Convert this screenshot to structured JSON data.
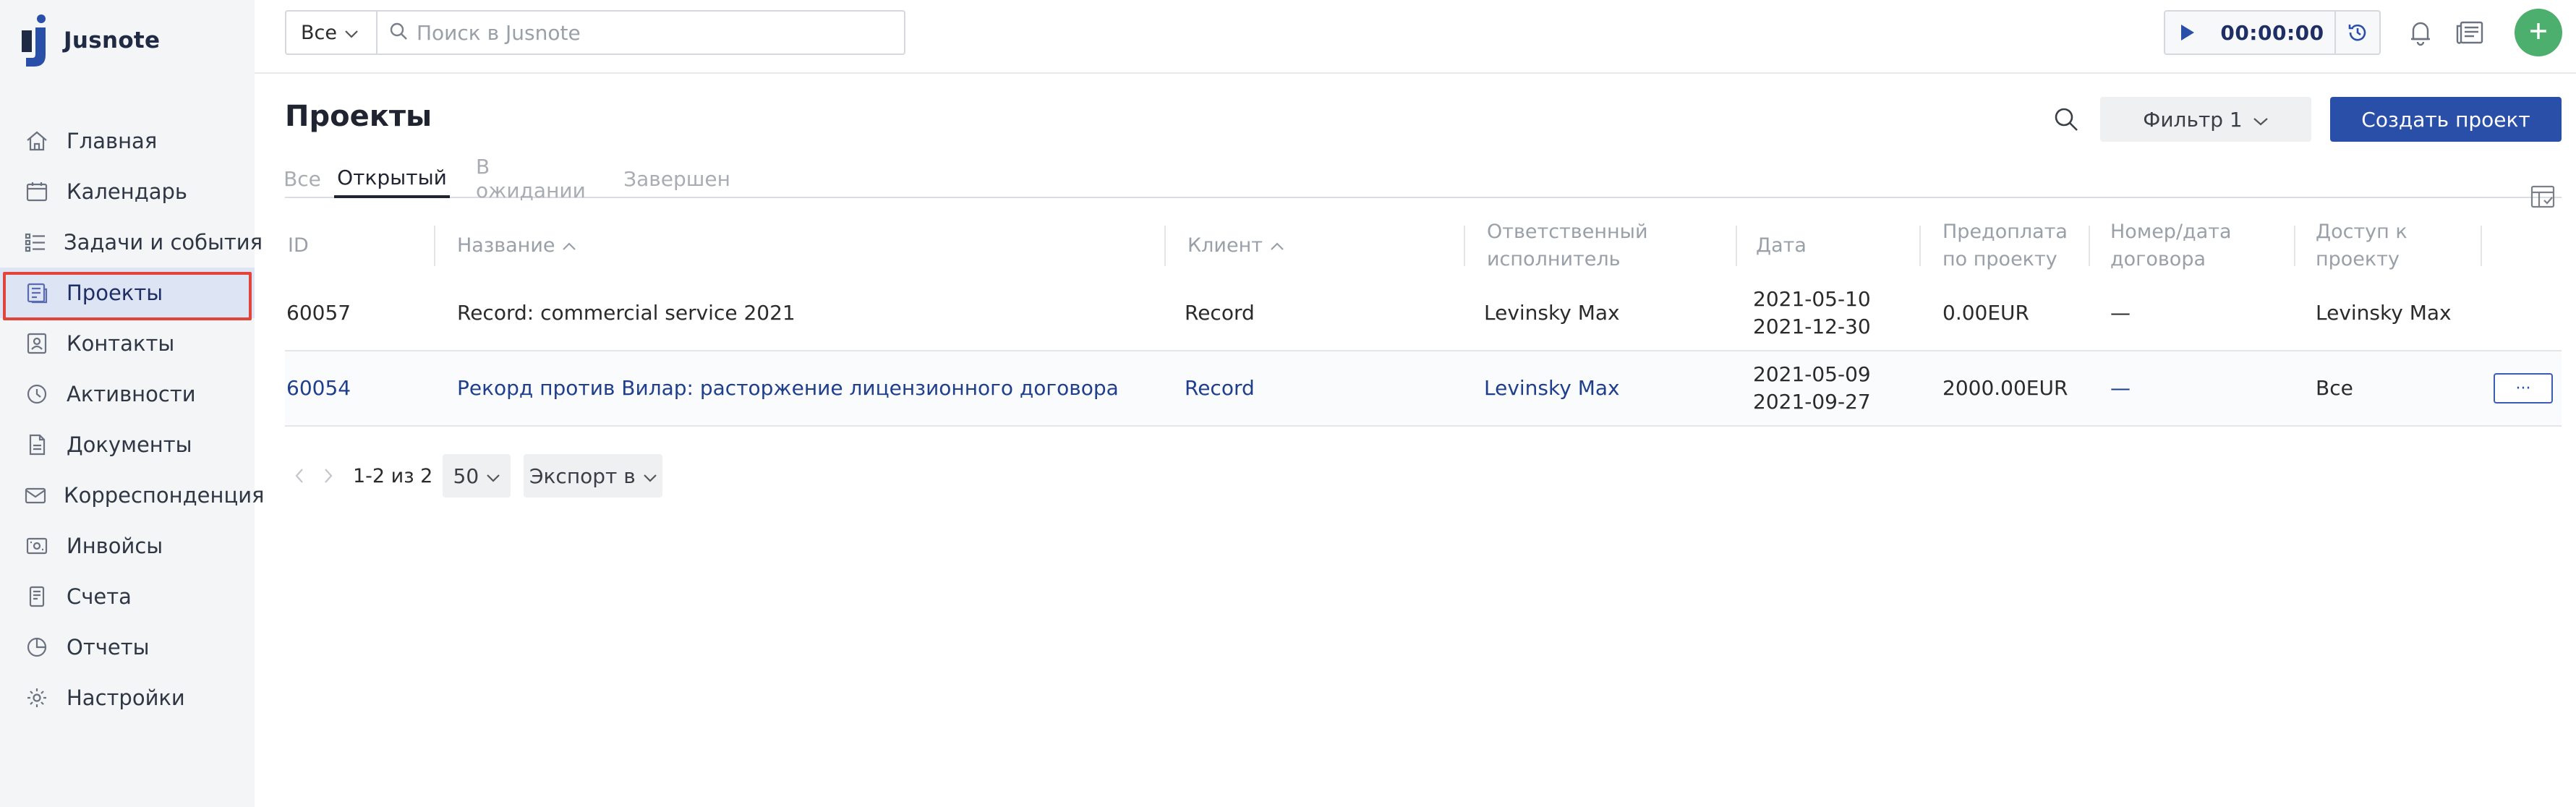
{
  "app": {
    "name": "Jusnote",
    "brand_color": "#2a4fa8",
    "accent_add": "#4caf6d",
    "highlight": "#e0443a"
  },
  "sidebar": {
    "items": [
      {
        "label": "Главная",
        "icon": "home-icon"
      },
      {
        "label": "Календарь",
        "icon": "calendar-icon"
      },
      {
        "label": "Задачи и события",
        "icon": "tasks-icon"
      },
      {
        "label": "Проекты",
        "icon": "projects-icon",
        "active": true
      },
      {
        "label": "Контакты",
        "icon": "contacts-icon"
      },
      {
        "label": "Активности",
        "icon": "activities-icon"
      },
      {
        "label": "Документы",
        "icon": "documents-icon"
      },
      {
        "label": "Корреспонденция",
        "icon": "correspondence-icon"
      },
      {
        "label": "Инвойсы",
        "icon": "invoices-icon"
      },
      {
        "label": "Счета",
        "icon": "accounts-icon"
      },
      {
        "label": "Отчеты",
        "icon": "reports-icon"
      },
      {
        "label": "Настройки",
        "icon": "settings-icon"
      }
    ]
  },
  "topbar": {
    "scope": "Все",
    "search_placeholder": "Поиск в Jusnote",
    "timer": "00:00:00"
  },
  "page": {
    "title": "Проекты",
    "filter_label": "Фильтр 1",
    "create_label": "Создать проект",
    "tabs": [
      "Все",
      "Открытый",
      "В ожидании",
      "Завершен"
    ],
    "active_tab": "Открытый"
  },
  "table": {
    "columns": {
      "id": "ID",
      "name": "Название",
      "client": "Клиент",
      "responsible_1": "Ответственный",
      "responsible_2": "исполнитель",
      "date": "Дата",
      "prepay_1": "Предоплата",
      "prepay_2": "по проекту",
      "contract_1": "Номер/дата",
      "contract_2": "договора",
      "access_1": "Доступ к",
      "access_2": "проекту"
    },
    "rows": [
      {
        "id": "60057",
        "name": "Record: commercial service 2021",
        "client": "Record",
        "responsible": "Levinsky Max",
        "date_start": "2021-05-10",
        "date_end": "2021-12-30",
        "prepay": "0.00EUR",
        "contract": "—",
        "access": "Levinsky Max"
      },
      {
        "id": "60054",
        "name": "Рекорд против Вилар: расторжение лицензионного договора",
        "client": "Record",
        "responsible": "Levinsky Max",
        "date_start": "2021-05-09",
        "date_end": "2021-09-27",
        "prepay": "2000.00EUR",
        "contract": "—",
        "access": "Все",
        "more": "···"
      }
    ]
  },
  "pager": {
    "range": "1-2 из 2",
    "page_size": "50",
    "export_label": "Экспорт в"
  }
}
